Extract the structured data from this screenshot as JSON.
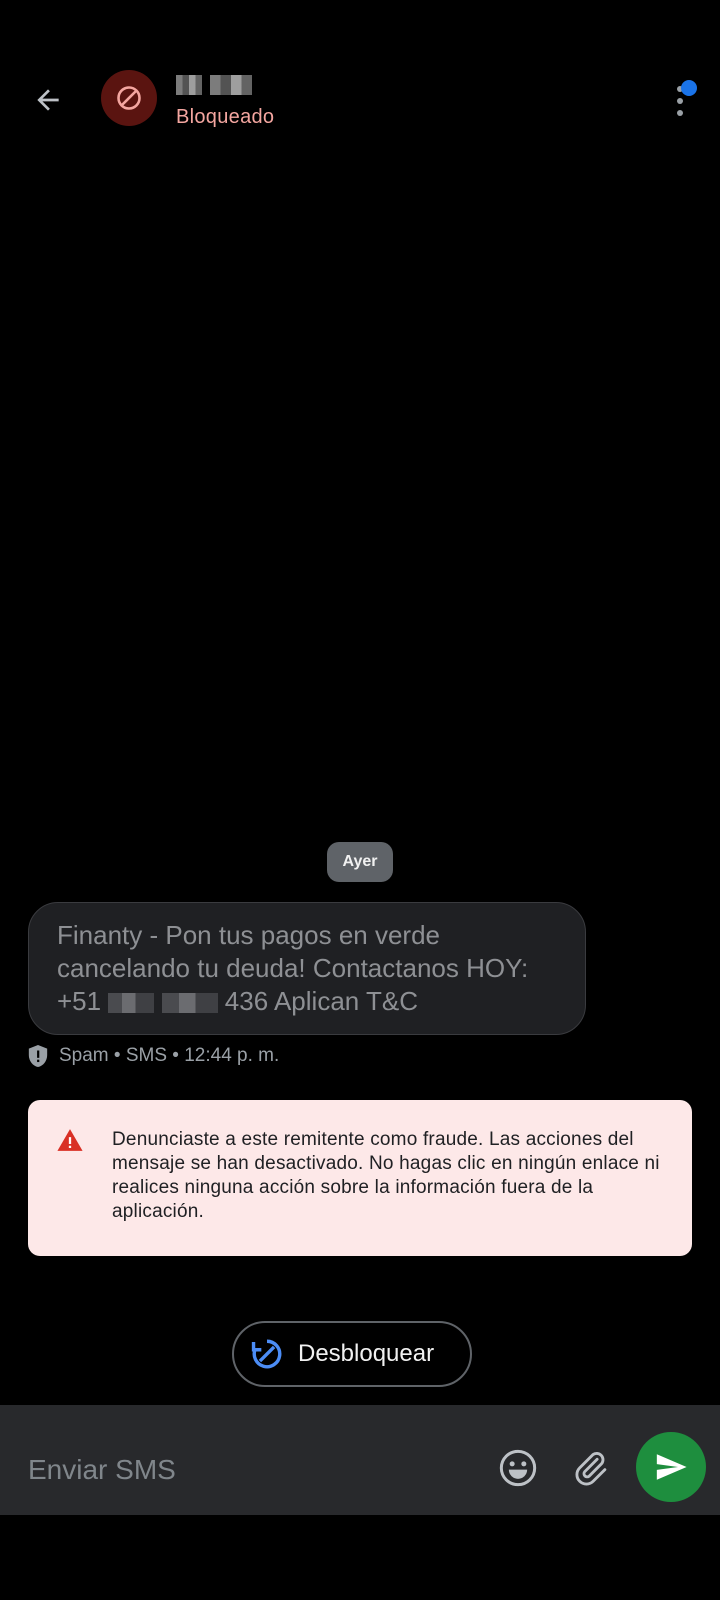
{
  "header": {
    "contact_status": "Bloqueado"
  },
  "conversation": {
    "date_label": "Ayer",
    "message": {
      "line1": "Finanty - Pon tus pagos en verde",
      "line2": "cancelando tu deuda! Contactanos HOY:",
      "line3_prefix": "+51 ",
      "line3_suffix": "436 Aplican T&C"
    },
    "meta": "Spam • SMS • 12:44 p. m."
  },
  "warning": {
    "text": "Denunciaste a este remitente como fraude. Las acciones del mensaje se han desactivado. No hagas clic en ningún enlace ni realices ninguna acción sobre la información fuera de la aplicación."
  },
  "unblock": {
    "label": "Desbloquear"
  },
  "composer": {
    "placeholder": "Enviar SMS"
  },
  "colors": {
    "status_red": "#f4a6a0",
    "avatar_bg": "#5a1410",
    "accent_blue": "#1a73e8",
    "send_green": "#1e8e3e",
    "warning_bg": "#fde8e8"
  },
  "icons": [
    "back-arrow-icon",
    "block-icon",
    "more-vert-icon",
    "shield-icon",
    "warning-icon",
    "unblock-icon",
    "emoji-icon",
    "attach-icon",
    "send-icon"
  ]
}
